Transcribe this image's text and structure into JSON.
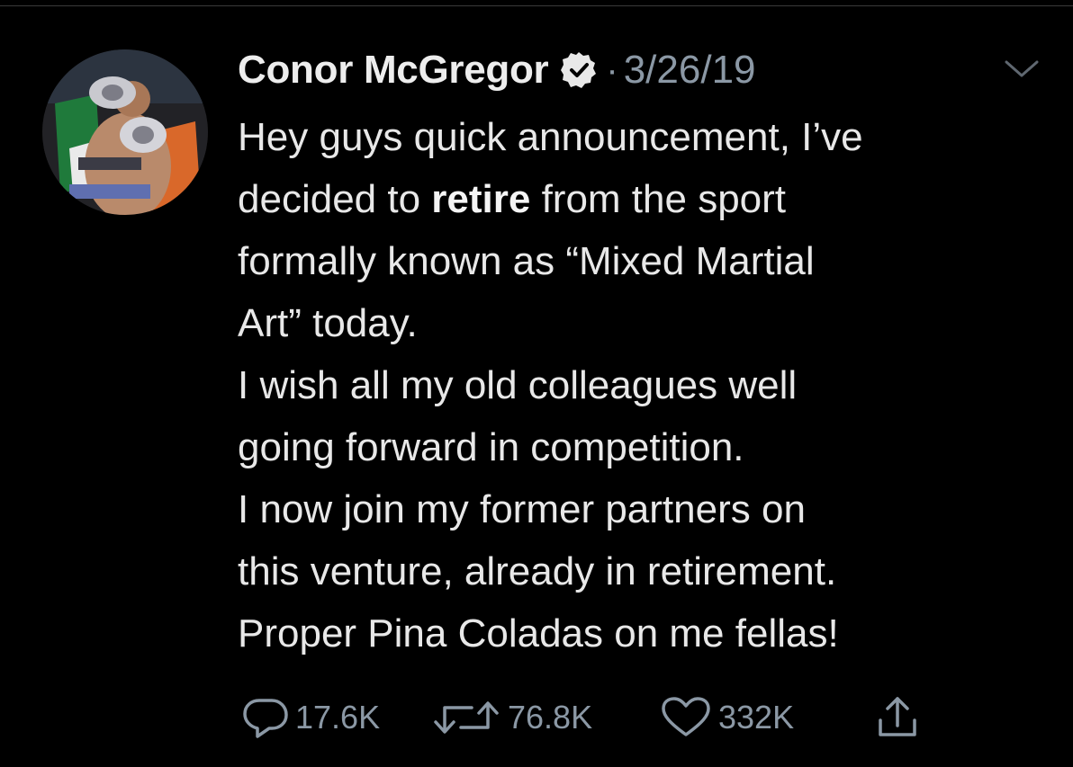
{
  "tweet": {
    "author_name": "Conor McGregor",
    "separator": "·",
    "date": "3/26/19",
    "verified": true,
    "lines": [
      {
        "parts": [
          {
            "text": "Hey guys quick announcement, I’ve",
            "bold": false
          }
        ]
      },
      {
        "parts": [
          {
            "text": "decided to ",
            "bold": false
          },
          {
            "text": "retire",
            "bold": true
          },
          {
            "text": " from the sport",
            "bold": false
          }
        ]
      },
      {
        "parts": [
          {
            "text": "formally known as “Mixed Martial",
            "bold": false
          }
        ]
      },
      {
        "parts": [
          {
            "text": "Art” today.",
            "bold": false
          }
        ]
      },
      {
        "parts": [
          {
            "text": "I wish all my old colleagues well",
            "bold": false
          }
        ]
      },
      {
        "parts": [
          {
            "text": "going forward in competition.",
            "bold": false
          }
        ]
      },
      {
        "parts": [
          {
            "text": "I now join my former partners on",
            "bold": false
          }
        ]
      },
      {
        "parts": [
          {
            "text": "this venture, already in retirement.",
            "bold": false
          }
        ]
      },
      {
        "parts": [
          {
            "text": "Proper Pina Coladas on me fellas!",
            "bold": false
          }
        ]
      }
    ]
  },
  "actions": {
    "reply_count": "17.6K",
    "retweet_count": "76.8K",
    "like_count": "332K"
  },
  "icons": {
    "verified": "verified-badge-icon",
    "menu": "chevron-down-icon",
    "reply": "reply-icon",
    "retweet": "retweet-icon",
    "like": "heart-icon",
    "share": "share-icon"
  },
  "colors": {
    "background": "#000000",
    "text": "#e8e8e8",
    "secondary": "#8b98a5",
    "verified_badge": "#e8e8e8"
  }
}
